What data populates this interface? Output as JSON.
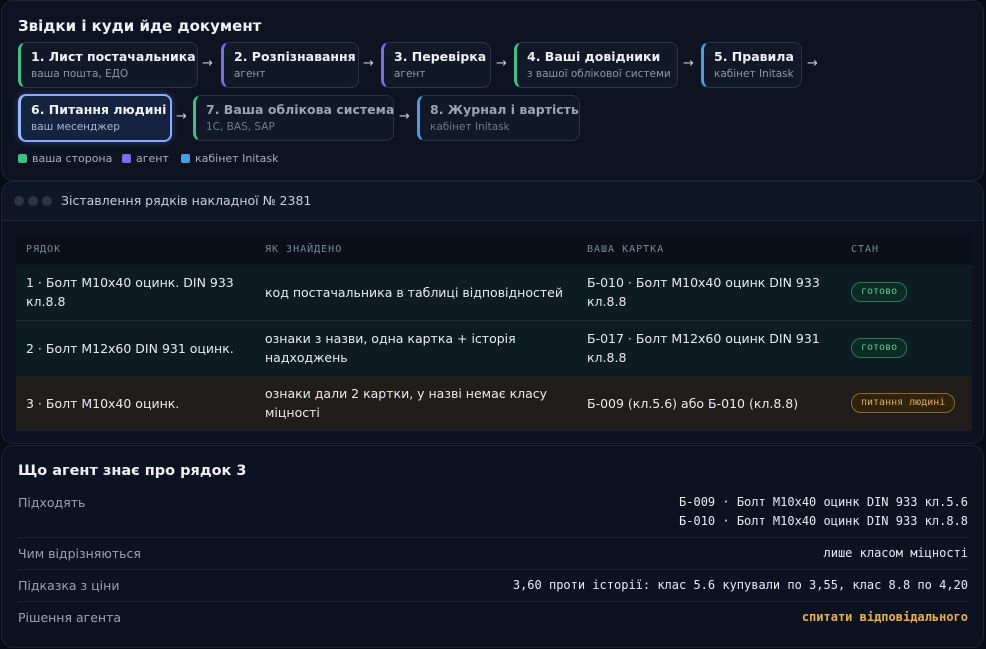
{
  "flow": {
    "title": "Звідки і куди йде документ",
    "steps": [
      {
        "title": "1. Лист постачальника",
        "sub": "ваша пошта, ЕДО",
        "side": "ваша сторона"
      },
      {
        "title": "2. Розпізнавання",
        "sub": "агент",
        "side": "агент"
      },
      {
        "title": "3. Перевірка",
        "sub": "агент",
        "side": "агент"
      },
      {
        "title": "4. Ваші довідники",
        "sub": "з вашої облікової системи",
        "side": "ваша сторона"
      },
      {
        "title": "5. Правила",
        "sub": "кабінет Initask",
        "side": "кабінет Initask"
      },
      {
        "title": "6. Питання людині",
        "sub": "ваш месенджер",
        "side": "ваша сторона",
        "active": true
      },
      {
        "title": "7. Ваша облікова система",
        "sub": "1С, BAS, SAP",
        "side": "ваша сторона"
      },
      {
        "title": "8. Журнал і вартість",
        "sub": "кабінет Initask",
        "side": "кабінет Initask"
      }
    ],
    "arrow": "→",
    "legend": [
      {
        "label": "ваша сторона",
        "color": "#3fbf84"
      },
      {
        "label": "агент",
        "color": "#7b6cf0"
      },
      {
        "label": "кабінет Initask",
        "color": "#4a9ee8"
      }
    ]
  },
  "matching": {
    "window_title": "Зіставлення рядків накладної № 2381",
    "columns": [
      "РЯДОК",
      "ЯК ЗНАЙДЕНО",
      "ВАША КАРТКА",
      "СТАН"
    ],
    "rows": [
      {
        "line": "1 · Болт М10х40 оцинк. DIN 933 кл.8.8",
        "how": "код постачальника в таблиці відповідностей",
        "card": "Б-010 · Болт М10х40 оцинк DIN 933 кл.8.8",
        "status": "готово",
        "status_kind": "ok"
      },
      {
        "line": "2 · Болт М12х60 DIN 931 оцинк.",
        "how": "ознаки з назви, одна картка + історія надходжень",
        "card": "Б-017 · Болт М12х60 оцинк DIN 931 кл.8.8",
        "status": "готово",
        "status_kind": "ok"
      },
      {
        "line": "3 · Болт М10х40 оцинк.",
        "how": "ознаки дали 2 картки, у назві немає класу міцності",
        "card": "Б-009 (кл.5.6) або Б-010 (кл.8.8)",
        "status": "питання людині",
        "status_kind": "ask"
      }
    ],
    "colors": {
      "ok": "#4fcf97",
      "ask": "#e0a84a"
    }
  },
  "details": {
    "title": "Що агент знає про рядок 3",
    "fits_label": "Підходять",
    "fits": [
      "Б-009 · Болт М10х40 оцинк DIN 933 кл.5.6",
      "Б-010 · Болт М10х40 оцинк DIN 933 кл.8.8"
    ],
    "diff_label": "Чим відрізняються",
    "diff": "лише класом міцності",
    "price_label": "Підказка з ціни",
    "price": "3,60 проти історії: клас 5.6 купували по 3,55, клас 8.8 по 4,20",
    "decision_label": "Рішення агента",
    "decision": "спитати відповідального"
  }
}
